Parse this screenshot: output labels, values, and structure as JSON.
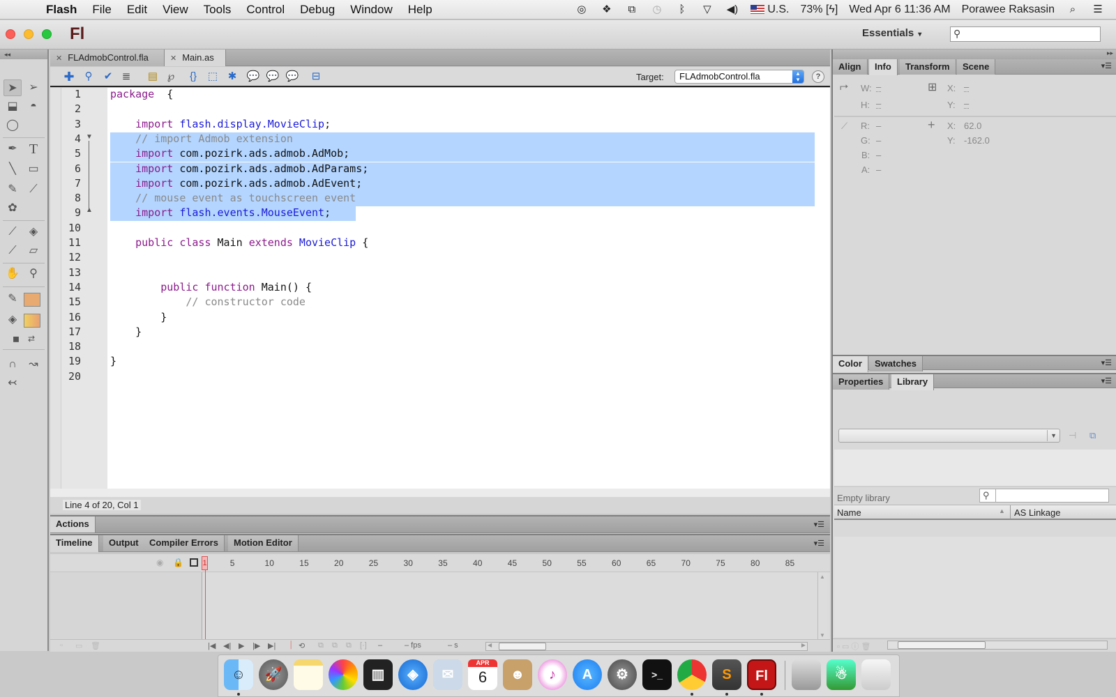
{
  "menubar": {
    "app": "Flash",
    "items": [
      "File",
      "Edit",
      "View",
      "Tools",
      "Control",
      "Debug",
      "Window",
      "Help"
    ],
    "input_source": "U.S.",
    "battery": "73%",
    "datetime": "Wed Apr 6  11:36 AM",
    "user": "Porawee Raksasin",
    "status_icons": [
      "creative-cloud-icon",
      "dropbox-icon",
      "sync-icon",
      "time-machine-icon",
      "bluetooth-icon",
      "wifi-icon",
      "volume-icon",
      "us-flag-icon",
      "battery-icon",
      "spotlight-icon",
      "notification-center-icon"
    ]
  },
  "window": {
    "logo": "Fl",
    "workspace": "Essentials",
    "search_placeholder": ""
  },
  "doc_tabs": [
    {
      "label": "FLAdmobControl.fla",
      "active": false
    },
    {
      "label": "Main.as",
      "active": true
    }
  ],
  "editor_toolbar": {
    "icons": [
      "add-script-icon",
      "find-icon",
      "check-syntax-icon",
      "auto-format-icon",
      "code-hint-icon",
      "debug-options-icon",
      "collapse-braces-icon",
      "collapse-selection-icon",
      "expand-all-icon",
      "block-comment-icon",
      "line-comment-icon",
      "remove-comment-icon",
      "toggle-toolbox-icon"
    ],
    "target_label": "Target:",
    "target_value": "FLAdmobControl.fla",
    "help": "?"
  },
  "editor": {
    "line_numbers": [
      "1",
      "2",
      "3",
      "4",
      "5",
      "6",
      "7",
      "8",
      "9",
      "10",
      "11",
      "12",
      "13",
      "14",
      "15",
      "16",
      "17",
      "18",
      "19",
      "20"
    ],
    "selected_lines": [
      4,
      9
    ],
    "lines": [
      [
        {
          "t": "package",
          "c": "kw"
        },
        {
          "t": "  {",
          "c": ""
        }
      ],
      [],
      [
        {
          "t": "    import",
          "c": "kw"
        },
        {
          "t": " flash.display.MovieClip",
          "c": "ty"
        },
        {
          "t": ";",
          "c": ""
        }
      ],
      [
        {
          "t": "    // import Admob extension",
          "c": "cm"
        }
      ],
      [
        {
          "t": "    import",
          "c": "kw"
        },
        {
          "t": " com.pozirk.ads.admob.AdMob;",
          "c": ""
        }
      ],
      [
        {
          "t": "    import",
          "c": "kw"
        },
        {
          "t": " com.pozirk.ads.admob.AdParams;",
          "c": ""
        }
      ],
      [
        {
          "t": "    import",
          "c": "kw"
        },
        {
          "t": " com.pozirk.ads.admob.AdEvent;",
          "c": ""
        }
      ],
      [
        {
          "t": "    // mouse event as touchscreen event",
          "c": "cm"
        }
      ],
      [
        {
          "t": "    import",
          "c": "kw"
        },
        {
          "t": " flash.events.MouseEvent",
          "c": "ty"
        },
        {
          "t": ";",
          "c": ""
        }
      ],
      [],
      [
        {
          "t": "    public class",
          "c": "kw"
        },
        {
          "t": " Main ",
          "c": ""
        },
        {
          "t": "extends",
          "c": "kw"
        },
        {
          "t": " MovieClip",
          "c": "ty"
        },
        {
          "t": " {",
          "c": ""
        }
      ],
      [],
      [],
      [
        {
          "t": "        public function",
          "c": "kw"
        },
        {
          "t": " Main() {",
          "c": ""
        }
      ],
      [
        {
          "t": "            // constructor code",
          "c": "cm"
        }
      ],
      [
        {
          "t": "        }",
          "c": ""
        }
      ],
      [
        {
          "t": "    }",
          "c": ""
        }
      ],
      [],
      [
        {
          "t": "}",
          "c": ""
        }
      ],
      []
    ],
    "status": "Line 4 of 20, Col 1"
  },
  "actions_panel": {
    "label": "Actions"
  },
  "bottom_tabs": [
    {
      "label": "Timeline",
      "active": true
    },
    {
      "label": "Output",
      "active": false
    },
    {
      "label": "Compiler Errors",
      "active": false
    },
    {
      "label": "Motion Editor",
      "active": false
    }
  ],
  "timeline": {
    "current_frame": "1",
    "ticks": [
      "5",
      "10",
      "15",
      "20",
      "25",
      "30",
      "35",
      "40",
      "45",
      "50",
      "55",
      "60",
      "65",
      "70",
      "75",
      "80",
      "85"
    ],
    "fps": "– fps",
    "seconds": "– s",
    "frame_readout": "–"
  },
  "info_panel": {
    "tabs": [
      {
        "label": "Align",
        "active": false
      },
      {
        "label": "Info",
        "active": true
      },
      {
        "label": "Transform",
        "active": false
      },
      {
        "label": "Scene",
        "active": false
      }
    ],
    "W": "–",
    "H": "–",
    "X": "–",
    "Y": "–",
    "R": "–",
    "G": "–",
    "B": "–",
    "A": "–",
    "cursor_x": "62.0",
    "cursor_y": "-162.0"
  },
  "color_panel": {
    "tabs": [
      {
        "label": "Color",
        "active": true
      },
      {
        "label": "Swatches",
        "active": false
      }
    ]
  },
  "library_panel": {
    "tabs": [
      {
        "label": "Properties",
        "active": false
      },
      {
        "label": "Library",
        "active": true
      }
    ],
    "status": "Empty library",
    "columns": [
      "Name",
      "AS Linkage"
    ]
  },
  "dock": {
    "apps": [
      {
        "name": "finder",
        "running": true
      },
      {
        "name": "launchpad",
        "running": false
      },
      {
        "name": "notes",
        "running": false
      },
      {
        "name": "photos",
        "running": false
      },
      {
        "name": "photo-slideshow",
        "running": false
      },
      {
        "name": "safari",
        "running": false
      },
      {
        "name": "mail",
        "running": false
      },
      {
        "name": "calendar",
        "running": false,
        "month": "APR",
        "day": "6"
      },
      {
        "name": "contacts",
        "running": false
      },
      {
        "name": "itunes",
        "running": false
      },
      {
        "name": "app-store",
        "running": false
      },
      {
        "name": "system-preferences",
        "running": false
      },
      {
        "name": "terminal",
        "running": false
      },
      {
        "name": "chrome",
        "running": true
      },
      {
        "name": "sublime-text",
        "running": true
      },
      {
        "name": "flash",
        "running": true
      },
      {
        "name": "downloads-stack",
        "running": false
      },
      {
        "name": "apps-stack",
        "running": false
      },
      {
        "name": "trash",
        "running": false
      }
    ]
  }
}
